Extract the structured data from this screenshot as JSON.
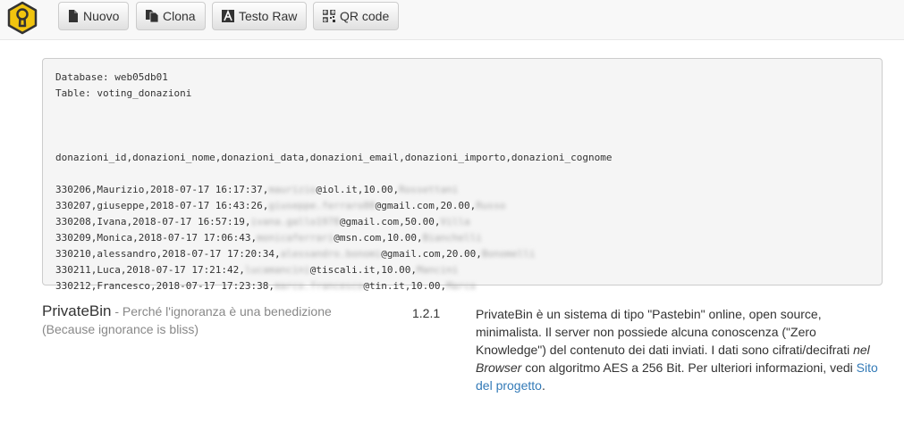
{
  "toolbar": {
    "buttons": [
      {
        "label": "Nuovo",
        "icon": "file-icon"
      },
      {
        "label": "Clona",
        "icon": "copy-icon"
      },
      {
        "label": "Testo Raw",
        "icon": "text-icon"
      },
      {
        "label": "QR code",
        "icon": "qrcode-icon"
      }
    ],
    "logo_icon": "keyhole-logo-icon",
    "logo_color": "#f1c40f"
  },
  "paste": {
    "lines": [
      {
        "parts": [
          {
            "t": "Database: web05db01"
          }
        ]
      },
      {
        "parts": [
          {
            "t": "Table: voting_donazioni"
          }
        ]
      },
      {
        "parts": []
      },
      {
        "parts": []
      },
      {
        "parts": []
      },
      {
        "parts": [
          {
            "t": "donazioni_id,donazioni_nome,donazioni_data,donazioni_email,donazioni_importo,donazioni_cognome"
          }
        ]
      },
      {
        "parts": []
      },
      {
        "parts": [
          {
            "t": "330206,Maurizio,2018-07-17 16:17:37,"
          },
          {
            "t": "maurizio",
            "blur": true
          },
          {
            "t": "@iol.it,10.00,"
          },
          {
            "t": "Rossettani",
            "blur": true
          }
        ]
      },
      {
        "parts": [
          {
            "t": "330207,giuseppe,2018-07-17 16:43:26,"
          },
          {
            "t": "giuseppe.ferraro80",
            "blur": true
          },
          {
            "t": "@gmail.com,20.00,"
          },
          {
            "t": "Russo",
            "blur": true
          }
        ]
      },
      {
        "parts": [
          {
            "t": "330208,Ivana,2018-07-17 16:57:19,"
          },
          {
            "t": "ivana.gallo1978",
            "blur": true
          },
          {
            "t": "@gmail.com,50.00,"
          },
          {
            "t": "Villa",
            "blur": true
          }
        ]
      },
      {
        "parts": [
          {
            "t": "330209,Monica,2018-07-17 17:06:43,"
          },
          {
            "t": "monicaferrari",
            "blur": true
          },
          {
            "t": "@msn.com,10.00,"
          },
          {
            "t": "Bianchelli",
            "blur": true
          }
        ]
      },
      {
        "parts": [
          {
            "t": "330210,alessandro,2018-07-17 17:20:34,"
          },
          {
            "t": "alessandro.bonomi",
            "blur": true
          },
          {
            "t": "@gmail.com,20.00,"
          },
          {
            "t": "Bonomelli",
            "blur": true
          }
        ]
      },
      {
        "parts": [
          {
            "t": "330211,Luca,2018-07-17 17:21:42,"
          },
          {
            "t": "lucamancini",
            "blur": true
          },
          {
            "t": "@tiscali.it,10.00,"
          },
          {
            "t": "Mancini",
            "blur": true
          }
        ]
      },
      {
        "parts": [
          {
            "t": "330212,Francesco,2018-07-17 17:23:38,"
          },
          {
            "t": "marco.francesco",
            "blur": true
          },
          {
            "t": "@tin.it,10.00,"
          },
          {
            "t": "Marco",
            "blur": true
          }
        ]
      }
    ]
  },
  "footer": {
    "name": "PrivateBin",
    "tagline": " - Perché l'ignoranza è una benedizione",
    "tagline_en": "(Because ignorance is bliss)",
    "version": "1.2.1",
    "desc_part1": "PrivateBin è un sistema di tipo \"Pastebin\" online, open source, minimalista. Il server non possiede alcuna conoscenza (\"Zero Knowledge\") del contenuto dei dati inviati. I dati sono cifrati/decifrati ",
    "desc_em": "nel Browser",
    "desc_part2": " con algoritmo AES a 256 Bit. Per ulteriori informazioni, vedi ",
    "link_text": "Sito del progetto",
    "desc_end": ".",
    "link_color": "#337ab7"
  }
}
